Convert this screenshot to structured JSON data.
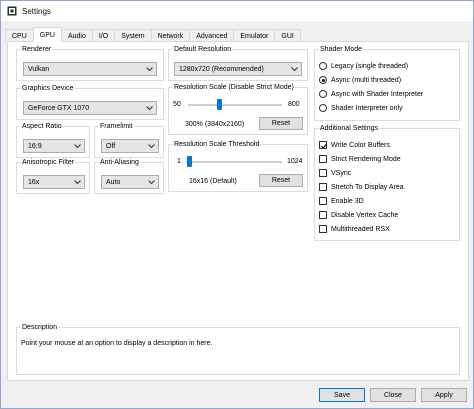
{
  "window": {
    "title": "Settings"
  },
  "tabs": [
    "CPU",
    "GPU",
    "Audio",
    "I/O",
    "System",
    "Network",
    "Advanced",
    "Emulator",
    "GUI"
  ],
  "renderer": {
    "title": "Renderer",
    "value": "Vulkan"
  },
  "graphics_device": {
    "title": "Graphics Device",
    "value": "GeForce GTX 1070"
  },
  "aspect_ratio": {
    "title": "Aspect Ratio",
    "value": "16:9"
  },
  "framelimit": {
    "title": "Framelimit",
    "value": "Off"
  },
  "anisotropic": {
    "title": "Anisotropic Filter",
    "value": "16x"
  },
  "anti_aliasing": {
    "title": "Anti-Aliasing",
    "value": "Auto"
  },
  "default_resolution": {
    "title": "Default Resolution",
    "value": "1280x720 (Recommended)"
  },
  "resolution_scale": {
    "title": "Resolution Scale (Disable Strict Mode)",
    "min": "50",
    "max": "800",
    "value_text": "300% (3840x2160)",
    "level": 0.33,
    "reset_label": "Reset"
  },
  "scale_threshold": {
    "title": "Resolution Scale Threshold",
    "min": "1",
    "max": "1024",
    "value_text": "16x16 (Default)",
    "level": 0.015,
    "reset_label": "Reset"
  },
  "shader_mode": {
    "title": "Shader Mode",
    "options": [
      {
        "label": "Legacy (single threaded)",
        "selected": false
      },
      {
        "label": "Async (multi threaded)",
        "selected": true
      },
      {
        "label": "Async with Shader Interpreter",
        "selected": false
      },
      {
        "label": "Shader Interpreter only",
        "selected": false
      }
    ]
  },
  "additional": {
    "title": "Additional Settings",
    "options": [
      {
        "label": "Write Color Buffers",
        "checked": true
      },
      {
        "label": "Strict Rendering Mode",
        "checked": false
      },
      {
        "label": "VSync",
        "checked": false
      },
      {
        "label": "Stretch To Display Area",
        "checked": false
      },
      {
        "label": "Enable 3D",
        "checked": false
      },
      {
        "label": "Disable Vertex Cache",
        "checked": false
      },
      {
        "label": "Multithreaded RSX",
        "checked": false
      }
    ]
  },
  "description": {
    "title": "Description",
    "text": "Point your mouse at an option to display a description in here."
  },
  "footer": {
    "save": "Save",
    "close": "Close",
    "apply": "Apply"
  },
  "colors": {
    "accent": "#0078d7",
    "panel": "#ffffff",
    "window": "#f0f0f0"
  }
}
